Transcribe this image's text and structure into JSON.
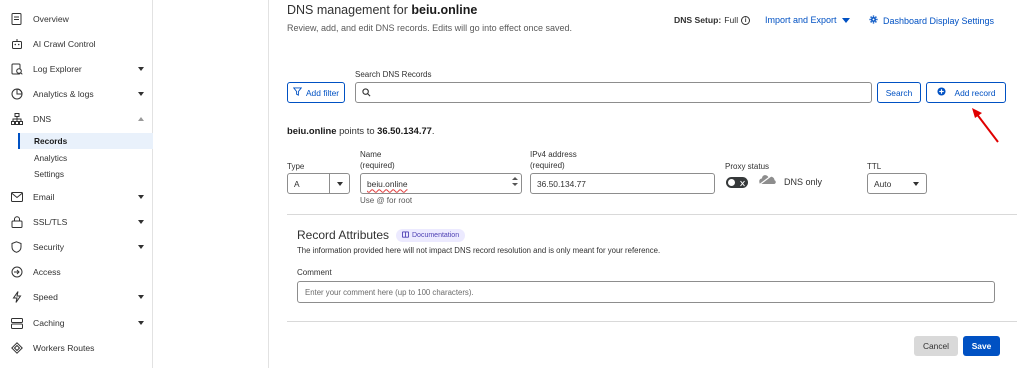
{
  "sidebar": {
    "items": [
      {
        "label": "Overview",
        "icon": "document-icon"
      },
      {
        "label": "AI Crawl Control",
        "icon": "robot-icon"
      },
      {
        "label": "Log Explorer",
        "icon": "log-icon"
      },
      {
        "label": "Analytics & logs",
        "icon": "clock-chart-icon"
      },
      {
        "label": "DNS",
        "icon": "network-tree-icon"
      },
      {
        "label": "Email",
        "icon": "envelope-icon"
      },
      {
        "label": "SSL/TLS",
        "icon": "lock-icon"
      },
      {
        "label": "Security",
        "icon": "shield-icon"
      },
      {
        "label": "Access",
        "icon": "access-icon"
      },
      {
        "label": "Speed",
        "icon": "lightning-icon"
      },
      {
        "label": "Caching",
        "icon": "stack-icon"
      },
      {
        "label": "Workers Routes",
        "icon": "diamond-icon"
      }
    ],
    "dns_subitems": [
      "Records",
      "Analytics",
      "Settings"
    ]
  },
  "header": {
    "title_prefix": "DNS management for ",
    "domain": "beiu.online",
    "subtitle": "Review, add, and edit DNS records. Edits will go into effect once saved.",
    "dns_setup_label": "DNS Setup:",
    "dns_setup_value": "Full",
    "import_export": "Import and Export",
    "dashboard_settings": "Dashboard Display Settings"
  },
  "search": {
    "add_filter": "Add filter",
    "label": "Search DNS Records",
    "placeholder": "",
    "search_button": "Search",
    "add_record": "Add record"
  },
  "points_to": {
    "domain": "beiu.online",
    "text": " points to ",
    "ip": "36.50.134.77",
    "end": "."
  },
  "form": {
    "type_label": "Type",
    "type_value": "A",
    "name_label": "Name",
    "name_required": "(required)",
    "name_value": "beiu.online",
    "name_hint": "Use @ for root",
    "ipv4_label": "IPv4 address",
    "ipv4_required": "(required)",
    "ipv4_value": "36.50.134.77",
    "proxy_label": "Proxy status",
    "proxy_value": "DNS only",
    "ttl_label": "TTL",
    "ttl_value": "Auto"
  },
  "attributes": {
    "title": "Record Attributes",
    "doc_badge": "Documentation",
    "description": "The information provided here will not impact DNS record resolution and is only meant for your reference.",
    "comment_label": "Comment",
    "comment_placeholder": "Enter your comment here (up to 100 characters)."
  },
  "actions": {
    "cancel": "Cancel",
    "save": "Save"
  },
  "colors": {
    "primary": "#0051c3",
    "annotation_arrow": "#e00000"
  }
}
